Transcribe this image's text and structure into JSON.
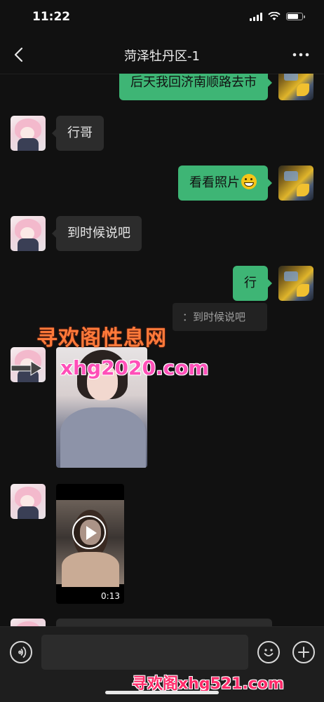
{
  "status_bar": {
    "time": "11:22",
    "battery_level": 0.8
  },
  "header": {
    "title": "菏泽牡丹区-1"
  },
  "messages": [
    {
      "side": "out",
      "text": "后天我回济南顺路去市"
    },
    {
      "side": "in",
      "text": "行哥"
    },
    {
      "side": "out",
      "text": "看看照片",
      "emoji": "grinning-face-emoji"
    },
    {
      "side": "in",
      "text": "到时候说吧"
    },
    {
      "side": "out",
      "text": "行"
    },
    {
      "side": "out",
      "type": "quote",
      "text": "：到时候说吧"
    },
    {
      "side": "in",
      "type": "image"
    },
    {
      "side": "in",
      "type": "video",
      "duration": "0:13"
    }
  ],
  "watermark": {
    "title": "寻欢阁性息网",
    "url": "xhg2020.com",
    "footer": "寻欢阁xhg521.com"
  },
  "input": {
    "value": "",
    "placeholder": ""
  },
  "colors": {
    "background": "#111111",
    "outgoing_bubble": "#3eb575",
    "incoming_bubble": "#2c2c2c"
  },
  "icons": [
    "back-icon",
    "more-icon",
    "voice-icon",
    "emoji-icon",
    "plus-icon",
    "play-icon"
  ]
}
